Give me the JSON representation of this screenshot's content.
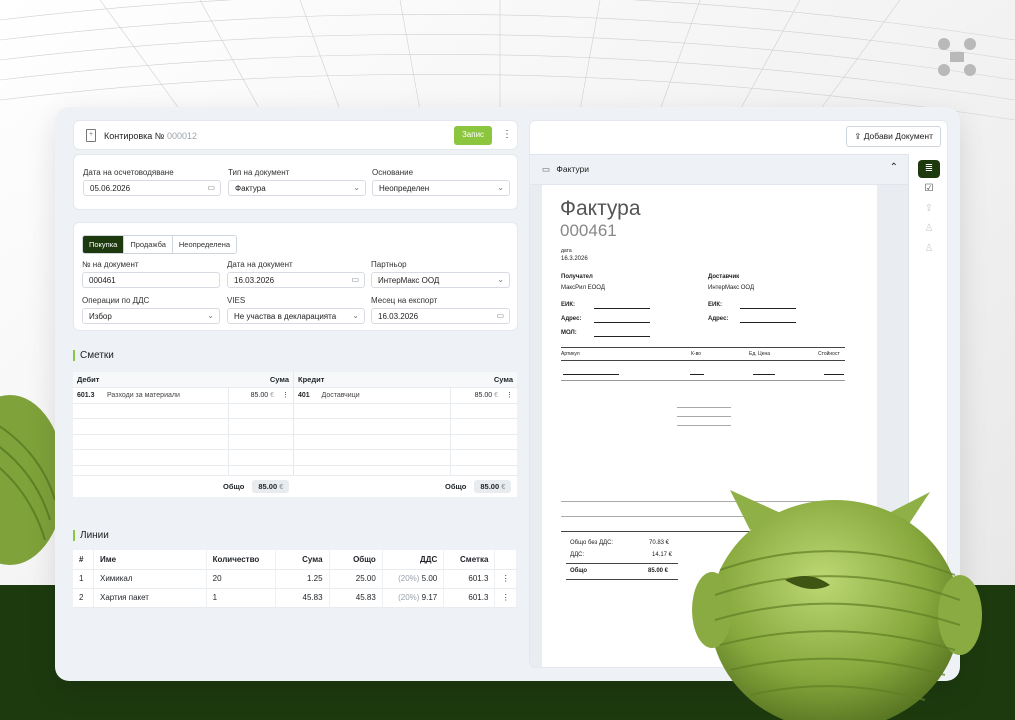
{
  "header": {
    "title": "Контировка №",
    "number": "000012",
    "save_label": "Запис",
    "more_icon": "kebab-icon"
  },
  "posting": {
    "accounting_date_label": "Дата на осчетоводяване",
    "accounting_date": "05.06.2026",
    "doc_type_label": "Тип на документ",
    "doc_type": "Фактура",
    "basis_label": "Основание",
    "basis": "Неопределен"
  },
  "details": {
    "tabs": [
      "Покупка",
      "Продажба",
      "Неопределена"
    ],
    "active_tab": 0,
    "doc_no_label": "№ на документ",
    "doc_no": "000461",
    "doc_date_label": "Дата на документ",
    "doc_date": "16.03.2026",
    "partner_label": "Партньор",
    "partner": "ИнтерМакс ООД",
    "vat_ops_label": "Операции по ДДС",
    "vat_ops": "Избор",
    "vies_label": "VIES",
    "vies": "Не участва в декларацията",
    "export_month_label": "Месец на експорт",
    "export_month": "16.03.2026"
  },
  "accounts": {
    "section_title": "Сметки",
    "debit_header": "Дебит",
    "credit_header": "Кредит",
    "amount_header": "Сума",
    "debit_rows": [
      {
        "code": "601.3",
        "name": "Разходи за материали",
        "amount": "85.00",
        "currency": "€"
      }
    ],
    "credit_rows": [
      {
        "code": "401",
        "name": "Доставчици",
        "amount": "85.00",
        "currency": "€"
      }
    ],
    "total_label": "Общо",
    "debit_total": "85.00",
    "credit_total": "85.00",
    "currency": "€"
  },
  "lines": {
    "section_title": "Линии",
    "headers": [
      "#",
      "Име",
      "Количество",
      "Сума",
      "Общо",
      "ДДС",
      "Сметка"
    ],
    "rows": [
      {
        "idx": "1",
        "name": "Химикал",
        "qty": "20",
        "amount": "1.25",
        "total": "25.00",
        "vat_rate": "(20%)",
        "vat": "5.00",
        "account": "601.3"
      },
      {
        "idx": "2",
        "name": "Хартия пакет",
        "qty": "1",
        "amount": "45.83",
        "total": "45.83",
        "vat_rate": "(20%)",
        "vat": "9.17",
        "account": "601.3"
      }
    ]
  },
  "document_panel": {
    "add_document_label": "Добави Документ",
    "folder_label": "Фактури"
  },
  "invoice": {
    "title": "Фактура",
    "number": "000461",
    "date_label": "дата",
    "date": "16.3.2026",
    "recipient_label": "Получател",
    "recipient": "МаксРил ЕООД",
    "supplier_label": "Доставчик",
    "supplier": "ИнтерМакс ООД",
    "eik_label": "ЕИК:",
    "address_label": "Адрес:",
    "mol_label": "МОЛ:",
    "col_item": "Артикул",
    "col_qty": "К-во",
    "col_price": "Ед. Цена",
    "col_value": "Стойност",
    "subtotal_label": "Общо без ДДС:",
    "subtotal": "70.83 €",
    "vat_label": "ДДС:",
    "vat": "14.17 €",
    "total_label": "Общо",
    "total": "85.00 €"
  },
  "colors": {
    "brand_dark": "#1d3a0f",
    "brand_accent": "#8cc63f"
  }
}
